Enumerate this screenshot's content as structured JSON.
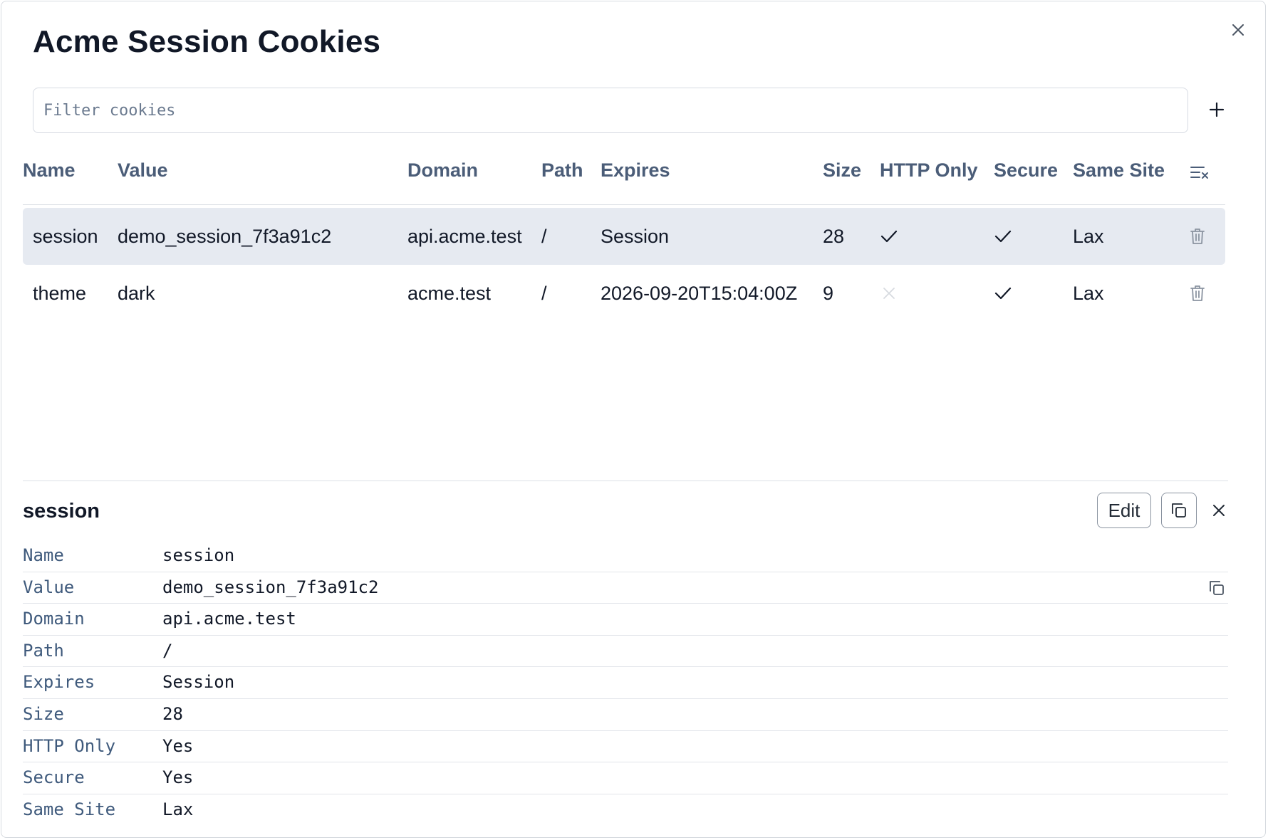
{
  "dialog": {
    "title": "Acme Session Cookies",
    "filter_placeholder": "Filter cookies",
    "filter_value": ""
  },
  "table": {
    "columns": [
      "Name",
      "Value",
      "Domain",
      "Path",
      "Expires",
      "Size",
      "HTTP Only",
      "Secure",
      "Same Site"
    ],
    "rows": [
      {
        "name": "session",
        "value": "demo_session_7f3a91c2",
        "domain": "api.acme.test",
        "path": "/",
        "expires": "Session",
        "size": "28",
        "http_only": true,
        "secure": true,
        "same_site": "Lax",
        "selected": true
      },
      {
        "name": "theme",
        "value": "dark",
        "domain": "acme.test",
        "path": "/",
        "expires": "2026-09-20T15:04:00Z",
        "size": "9",
        "http_only": false,
        "secure": true,
        "same_site": "Lax",
        "selected": false
      }
    ]
  },
  "detail": {
    "title": "session",
    "edit_label": "Edit",
    "properties": [
      {
        "key": "Name",
        "value": "session"
      },
      {
        "key": "Value",
        "value": "demo_session_7f3a91c2"
      },
      {
        "key": "Domain",
        "value": "api.acme.test"
      },
      {
        "key": "Path",
        "value": "/"
      },
      {
        "key": "Expires",
        "value": "Session"
      },
      {
        "key": "Size",
        "value": "28"
      },
      {
        "key": "HTTP Only",
        "value": "Yes"
      },
      {
        "key": "Secure",
        "value": "Yes"
      },
      {
        "key": "Same Site",
        "value": "Lax"
      }
    ]
  },
  "icons": {
    "dialog_close": "close-icon",
    "add": "plus-icon",
    "clear_all": "clear-list-icon",
    "delete": "trash-icon",
    "check": "check-icon",
    "cross": "x-icon",
    "copy": "copy-icon",
    "detail_close": "close-icon"
  },
  "colors": {
    "header_text": "#4b5d78",
    "selected_row": "#e6eaf1",
    "key_text": "#3f5a7c",
    "muted_icon": "#8a93a0",
    "disabled_cross": "#d7dbe0"
  }
}
